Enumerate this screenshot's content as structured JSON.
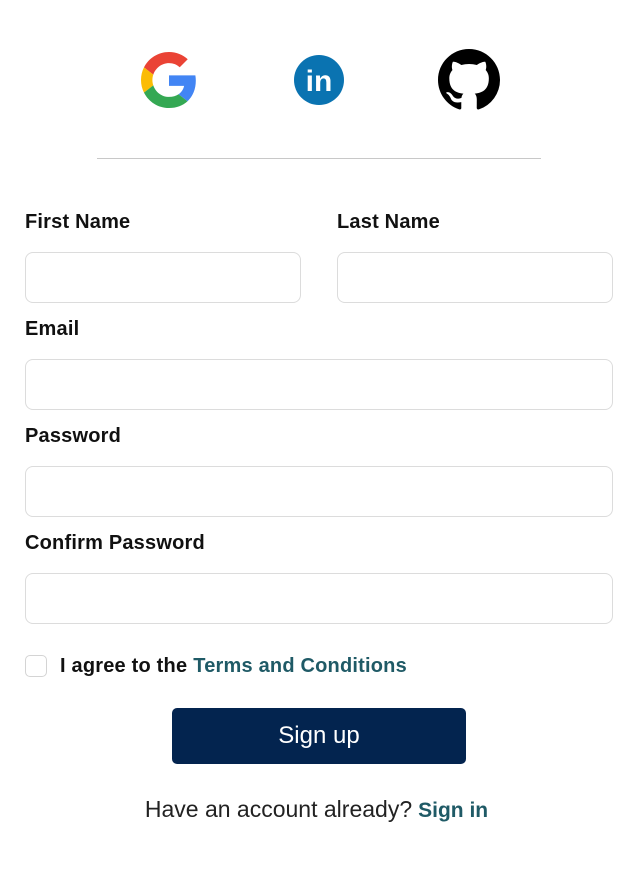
{
  "social": {
    "buttons": [
      {
        "icon": "google-icon"
      },
      {
        "icon": "linkedin-icon",
        "text": "in",
        "color": "#0a73b1"
      },
      {
        "icon": "github-icon",
        "color": "#000000"
      }
    ]
  },
  "form": {
    "first_name": {
      "label": "First Name",
      "value": "",
      "placeholder": ""
    },
    "last_name": {
      "label": "Last Name",
      "value": "",
      "placeholder": ""
    },
    "email": {
      "label": "Email",
      "value": "",
      "placeholder": ""
    },
    "password": {
      "label": "Password",
      "value": "",
      "placeholder": ""
    },
    "confirm_password": {
      "label": "Confirm Password",
      "value": "",
      "placeholder": ""
    },
    "agree": {
      "checked": false,
      "text": "I agree to the",
      "link_text": "Terms and Conditions"
    },
    "submit_label": "Sign up"
  },
  "footer": {
    "text": "Have an account already?",
    "link_text": "Sign in"
  },
  "colors": {
    "primary_button": "#03244f",
    "link": "#1f5a66",
    "input_border": "#dcdcdc"
  }
}
